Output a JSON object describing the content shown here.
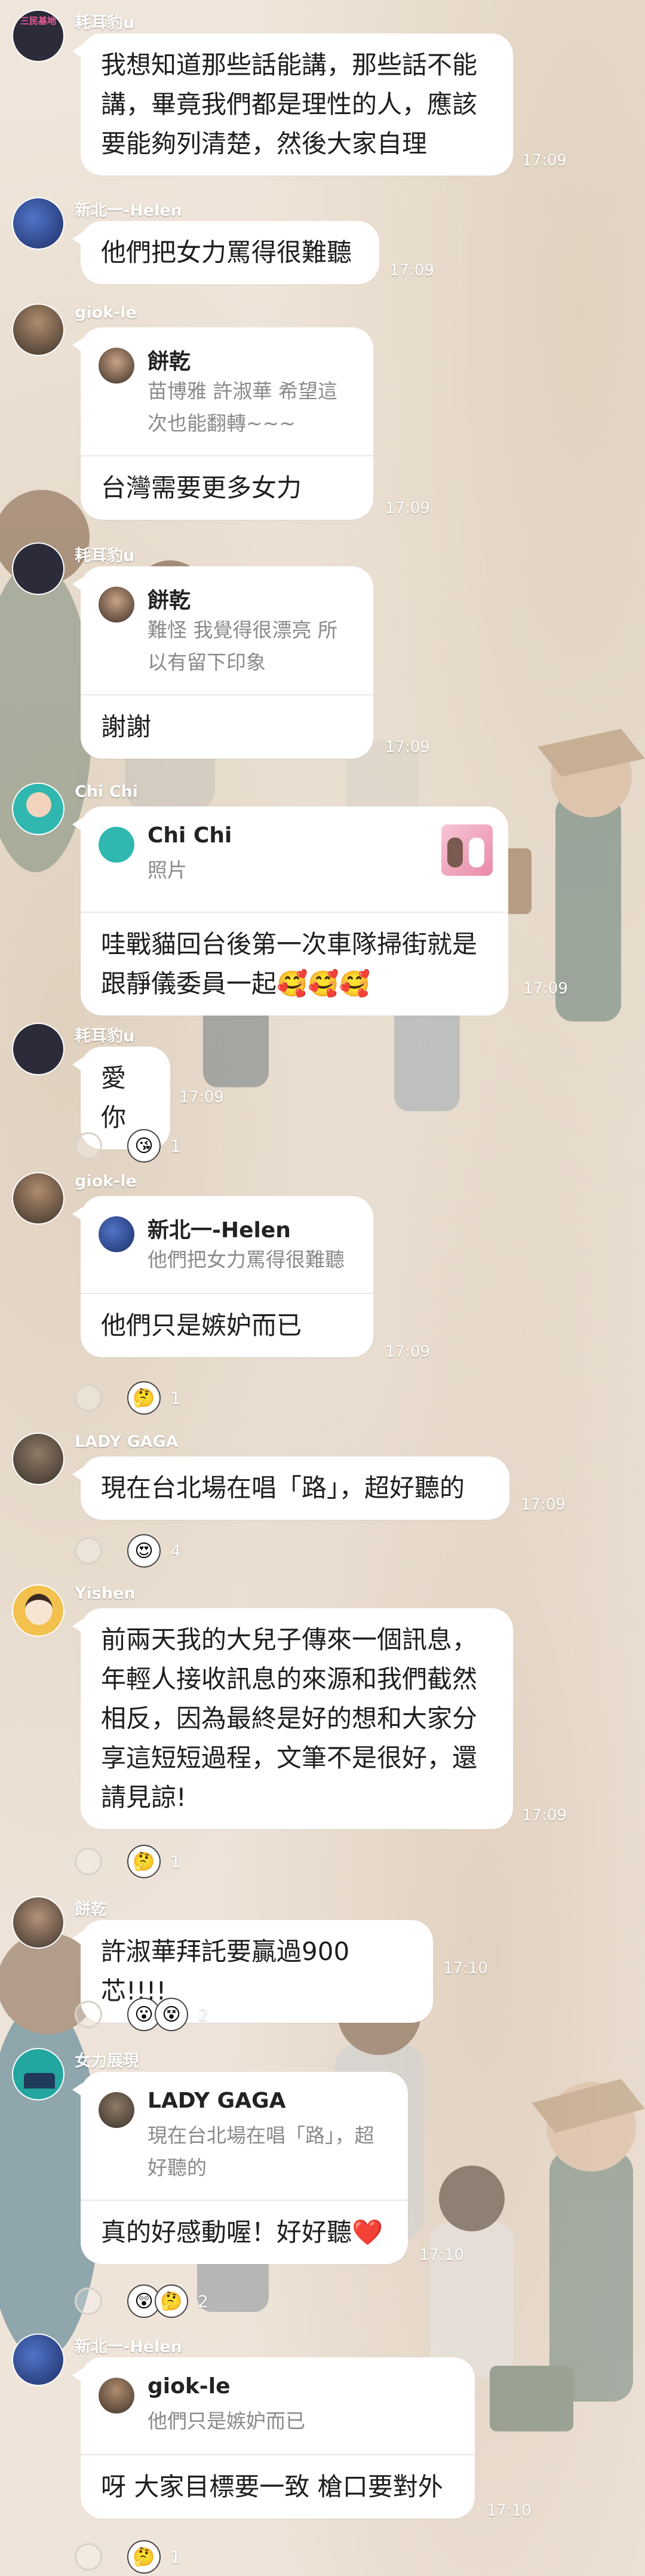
{
  "chat": {
    "messages": [
      {
        "sender": "耗耳豹u",
        "avatar_color": "#2b2b3a",
        "avatar_badge": "三民基地",
        "text": "我想知道那些話能講，那些話不能講，畢竟我們都是理性的人，應該要能夠列清楚，然後大家自理",
        "time": "17:09"
      },
      {
        "sender": "新北一-Helen",
        "avatar_color": "#2e4b92",
        "text": "他們把女力罵得很難聽",
        "time": "17:09"
      },
      {
        "sender": "giok-le",
        "avatar_color": "#4a3f36",
        "quote": {
          "name": "餅乾",
          "text": "苗博雅 許淑華 希望這次也能翻轉~~~"
        },
        "text": "台灣需要更多女力",
        "time": "17:09"
      },
      {
        "sender": "耗耳豹u",
        "avatar_color": "#2b2b3a",
        "quote": {
          "name": "餅乾",
          "text": "難怪  我覺得很漂亮  所以有留下印象"
        },
        "text": "謝謝",
        "time": "17:09"
      },
      {
        "sender": "Chi Chi",
        "avatar_color": "#2fb7b0",
        "quote": {
          "name": "Chi Chi",
          "text": "照片"
        },
        "text": "哇戰貓回台後第一次車隊掃街就是跟靜儀委員一起",
        "text_emoji": "🥰🥰🥰",
        "time": "17:09"
      },
      {
        "sender": "耗耳豹u",
        "avatar_color": "#2b2b3a",
        "text": "愛你",
        "time": "17:09",
        "reaction": {
          "emoji": "😘",
          "count": "1"
        }
      },
      {
        "sender": "giok-le",
        "avatar_color": "#4a3f36",
        "quote": {
          "name": "新北一-Helen",
          "text": "他們把女力罵得很難聽"
        },
        "text": "他們只是嫉妒而已",
        "time": "17:09",
        "reaction": {
          "emoji": "🤔",
          "count": "1"
        }
      },
      {
        "sender": "LADY GAGA",
        "avatar_color": "#5a5047",
        "text": "現在台北場在唱「路」，超好聽的",
        "time": "17:09",
        "reaction": {
          "emoji": "😍",
          "count": "4"
        }
      },
      {
        "sender": "Yishen",
        "avatar_color": "#f2c14e",
        "text": "前兩天我的大兒子傳來一個訊息，年輕人接收訊息的來源和我們截然相反，因為最終是好的想和大家分享這短短過程，文筆不是很好，還請見諒!",
        "time": "17:09",
        "reaction": {
          "emoji": "🤔",
          "count": "1"
        }
      },
      {
        "sender": "餅乾",
        "avatar_color": "#3d332c",
        "text": "許淑華拜託要贏過900芯!!!!",
        "time": "17:10",
        "reaction": {
          "emoji": "😮",
          "emoji2": "😵",
          "count": "2"
        }
      },
      {
        "sender": "女力展現",
        "avatar_color": "#23a6a0",
        "quote": {
          "name": "LADY GAGA",
          "text": "現在台北場在唱「路」，超好聽的"
        },
        "text": "真的好感動喔！好好聽",
        "text_emoji": "❤️",
        "time": "17:10",
        "reaction": {
          "emoji": "😲",
          "emoji2": "🤔",
          "count": "2"
        }
      },
      {
        "sender": "新北一-Helen",
        "avatar_color": "#2e4b92",
        "quote": {
          "name": "giok-le",
          "text": "他們只是嫉妒而已"
        },
        "text": "呀  大家目標要一致 槍口要對外",
        "time": "17:10",
        "reaction": {
          "emoji": "🤔",
          "count": "1"
        }
      }
    ]
  },
  "icons": {
    "add_reaction": "smile-outline-icon",
    "photo_thumb": "photo-thumbnail"
  },
  "colors": {
    "bubble": "#ffffff",
    "background": "#ede3d8",
    "name_text": "#ffffff"
  }
}
